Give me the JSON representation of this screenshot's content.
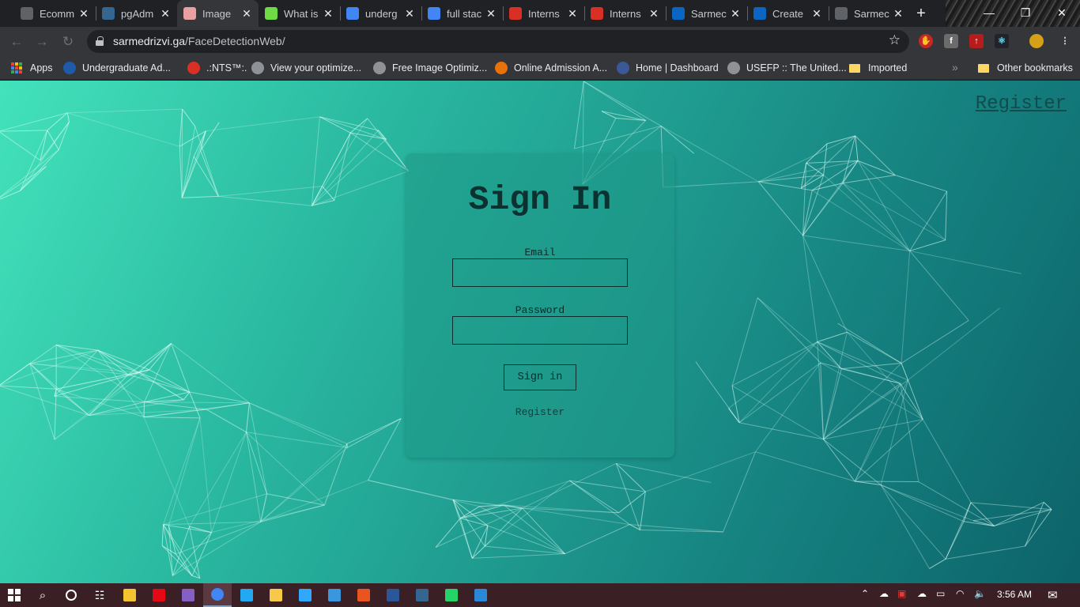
{
  "browser": {
    "tabs": [
      {
        "title": "Ecomm",
        "icon": "mountain-icon",
        "icon_color": "#5f6368",
        "active": false
      },
      {
        "title": "pgAdm",
        "icon": "pgadmin-icon",
        "icon_color": "#336791",
        "active": false
      },
      {
        "title": "Image",
        "icon": "brain-icon",
        "icon_color": "#e8a0a0",
        "active": true
      },
      {
        "title": "What is",
        "icon": "upwork-icon",
        "icon_color": "#6fda44",
        "active": false
      },
      {
        "title": "underg",
        "icon": "google-icon",
        "icon_color": "#4285f4",
        "active": false
      },
      {
        "title": "full stac",
        "icon": "google-icon",
        "icon_color": "#4285f4",
        "active": false
      },
      {
        "title": "Interns",
        "icon": "gmail-icon",
        "icon_color": "#d93025",
        "active": false
      },
      {
        "title": "Interns",
        "icon": "gmail-icon",
        "icon_color": "#d93025",
        "active": false
      },
      {
        "title": "Sarmec",
        "icon": "linkedin-icon",
        "icon_color": "#0a66c2",
        "active": false
      },
      {
        "title": "Create",
        "icon": "linkedin-icon",
        "icon_color": "#0a66c2",
        "active": false
      },
      {
        "title": "Sarmec",
        "icon": "globe-icon",
        "icon_color": "#5f6368",
        "active": false
      }
    ],
    "url_host": "sarmedrizvi.ga",
    "url_path": "/FaceDetectionWeb/",
    "bookmarks": [
      {
        "label": "Apps",
        "icon": "apps-grid-icon"
      },
      {
        "label": "Undergraduate Ad...",
        "icon": "university-icon",
        "color": "#1e5aa8"
      },
      {
        "label": ".:NTS™:.",
        "icon": "nts-icon",
        "color": "#d93025"
      },
      {
        "label": "View your optimize...",
        "icon": "globe-icon",
        "color": "#8e9196"
      },
      {
        "label": "Free Image Optimiz...",
        "icon": "globe-icon",
        "color": "#8e9196"
      },
      {
        "label": "Online Admission A...",
        "icon": "admission-icon",
        "color": "#e8710a"
      },
      {
        "label": "Home | Dashboard",
        "icon": "dashboard-icon",
        "color": "#3b5998"
      },
      {
        "label": "USEFP :: The United...",
        "icon": "globe-icon",
        "color": "#8e9196"
      },
      {
        "label": "Imported",
        "icon": "folder-icon",
        "color": "#fdd663"
      }
    ],
    "other_bookmarks": "Other bookmarks",
    "more_bookmarks": "»"
  },
  "page": {
    "top_register_link": "Register",
    "card": {
      "title": "Sign In",
      "email_label": "Email",
      "email_value": "",
      "password_label": "Password",
      "password_value": "",
      "signin_button": "Sign in",
      "register_link": "Register"
    }
  },
  "taskbar": {
    "apps": [
      {
        "name": "file-explorer-icon",
        "color": "#f4c430"
      },
      {
        "name": "netflix-icon",
        "color": "#e50914"
      },
      {
        "name": "visual-studio-icon",
        "color": "#865fc5"
      },
      {
        "name": "chrome-icon",
        "color": "#4285f4",
        "active": true
      },
      {
        "name": "vscode-icon",
        "color": "#23a9f2"
      },
      {
        "name": "python-icon",
        "color": "#f7c948"
      },
      {
        "name": "photoshop-icon",
        "color": "#31a8ff"
      },
      {
        "name": "notepad-icon",
        "color": "#3a96dd"
      },
      {
        "name": "ubuntu-icon",
        "color": "#e95420"
      },
      {
        "name": "word-icon",
        "color": "#2b579a"
      },
      {
        "name": "postgres-icon",
        "color": "#336791"
      },
      {
        "name": "whatsapp-icon",
        "color": "#25d366"
      },
      {
        "name": "notes-icon",
        "color": "#2b88d8"
      }
    ],
    "time": "3:56 AM"
  }
}
